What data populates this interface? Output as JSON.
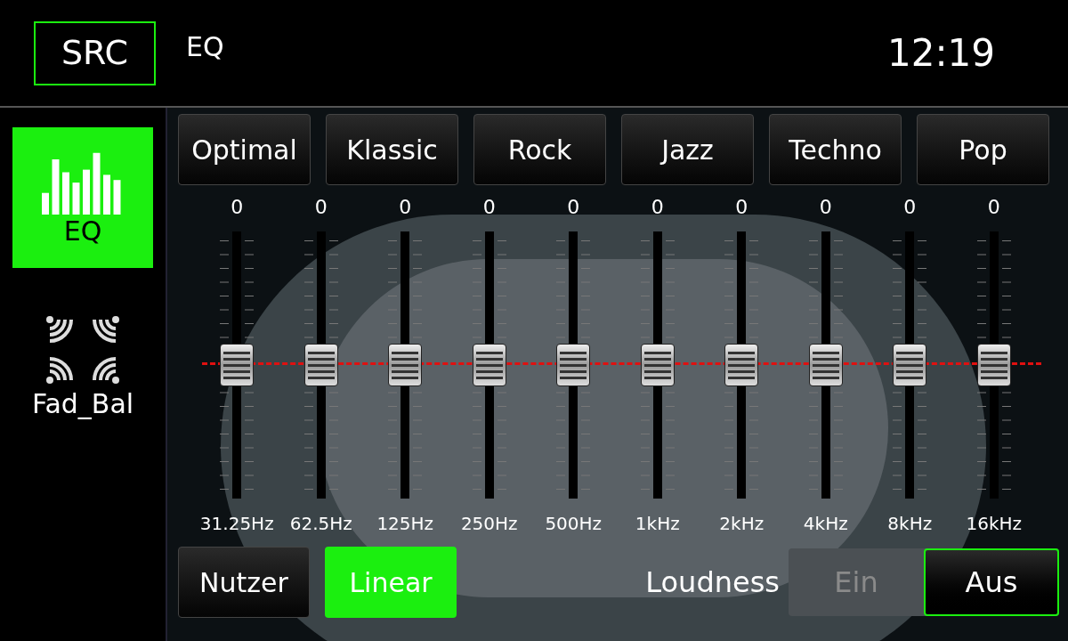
{
  "header": {
    "source_button": "SRC",
    "title": "EQ",
    "clock": "12:19"
  },
  "sidebar": {
    "items": [
      {
        "kind": "eq",
        "label": "EQ",
        "selected": true
      },
      {
        "kind": "fader",
        "label": "Fad_Bal",
        "selected": false
      }
    ]
  },
  "presets": [
    {
      "label": "Optimal",
      "selected": false
    },
    {
      "label": "Klassic",
      "selected": false
    },
    {
      "label": "Rock",
      "selected": false
    },
    {
      "label": "Jazz",
      "selected": false
    },
    {
      "label": "Techno",
      "selected": false
    },
    {
      "label": "Pop",
      "selected": false
    }
  ],
  "bands": [
    {
      "value": "0",
      "level": 0.5,
      "frequency": "31.25Hz"
    },
    {
      "value": "0",
      "level": 0.5,
      "frequency": "62.5Hz"
    },
    {
      "value": "0",
      "level": 0.5,
      "frequency": "125Hz"
    },
    {
      "value": "0",
      "level": 0.5,
      "frequency": "250Hz"
    },
    {
      "value": "0",
      "level": 0.5,
      "frequency": "500Hz"
    },
    {
      "value": "0",
      "level": 0.5,
      "frequency": "1kHz"
    },
    {
      "value": "0",
      "level": 0.5,
      "frequency": "2kHz"
    },
    {
      "value": "0",
      "level": 0.5,
      "frequency": "4kHz"
    },
    {
      "value": "0",
      "level": 0.5,
      "frequency": "8kHz"
    },
    {
      "value": "0",
      "level": 0.5,
      "frequency": "16kHz"
    }
  ],
  "modes": [
    {
      "label": "Nutzer",
      "selected": false
    },
    {
      "label": "Linear",
      "selected": true
    }
  ],
  "loudness": {
    "label": "Loudness",
    "options": [
      {
        "label": "Ein",
        "selected": false
      },
      {
        "label": "Aus",
        "selected": true
      }
    ]
  }
}
